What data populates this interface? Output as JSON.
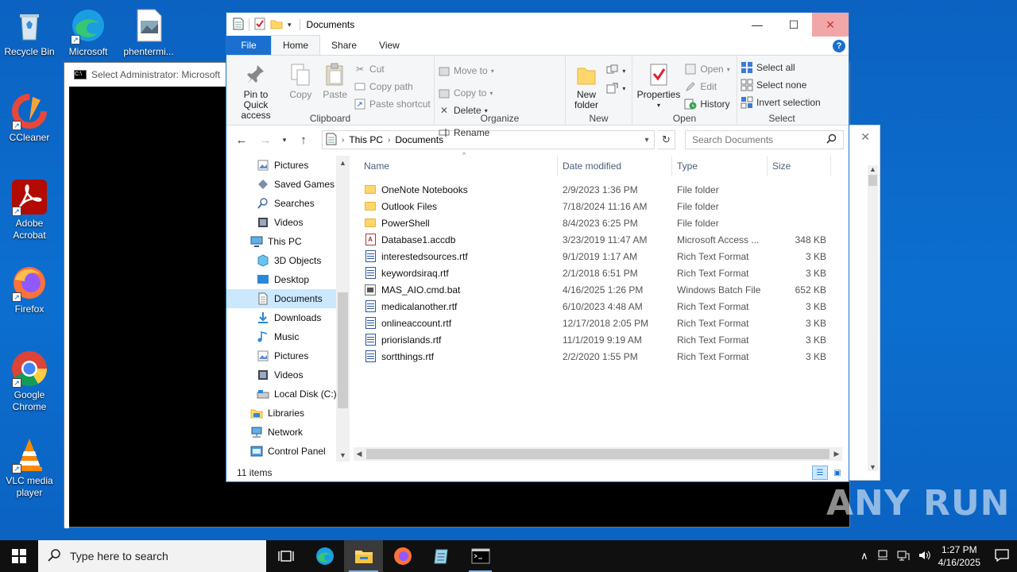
{
  "desktop": {
    "icons": [
      {
        "label": "Recycle Bin"
      },
      {
        "label": "Microsoft Edge"
      },
      {
        "label": "phentermi..."
      },
      {
        "label": "CCleaner"
      },
      {
        "label": "Adobe Acrobat"
      },
      {
        "label": "Firefox"
      },
      {
        "label": "Google Chrome"
      },
      {
        "label": "VLC media player"
      }
    ],
    "watermark": "ANY RUN"
  },
  "cmd": {
    "title": "Select Administrator:  Microsoft"
  },
  "explorer": {
    "title": "Documents",
    "tabs": [
      "File",
      "Home",
      "Share",
      "View"
    ],
    "ribbon": {
      "clipboard": {
        "label": "Clipboard",
        "pin": "Pin to Quick access",
        "copy": "Copy",
        "paste": "Paste",
        "cut": "Cut",
        "copy_path": "Copy path",
        "paste_shortcut": "Paste shortcut"
      },
      "organize": {
        "label": "Organize",
        "move_to": "Move to",
        "copy_to": "Copy to",
        "delete": "Delete",
        "rename": "Rename"
      },
      "new": {
        "label": "New",
        "new_folder": "New folder"
      },
      "open": {
        "label": "Open",
        "properties": "Properties",
        "open": "Open",
        "edit": "Edit",
        "history": "History"
      },
      "select": {
        "label": "Select",
        "select_all": "Select all",
        "select_none": "Select none",
        "invert": "Invert selection"
      }
    },
    "address": {
      "path": [
        "This PC",
        "Documents"
      ],
      "search_placeholder": "Search Documents"
    },
    "tree": [
      {
        "label": "Pictures",
        "icon": "pictures-icon",
        "indent": 2
      },
      {
        "label": "Saved Games",
        "icon": "saved-games-icon",
        "indent": 2
      },
      {
        "label": "Searches",
        "icon": "searches-icon",
        "indent": 2
      },
      {
        "label": "Videos",
        "icon": "videos-icon",
        "indent": 2
      },
      {
        "label": "This PC",
        "icon": "this-pc-icon",
        "indent": 1
      },
      {
        "label": "3D Objects",
        "icon": "3d-objects-icon",
        "indent": 2
      },
      {
        "label": "Desktop",
        "icon": "desktop-icon",
        "indent": 2
      },
      {
        "label": "Documents",
        "icon": "documents-icon",
        "indent": 2,
        "selected": true
      },
      {
        "label": "Downloads",
        "icon": "downloads-icon",
        "indent": 2
      },
      {
        "label": "Music",
        "icon": "music-icon",
        "indent": 2
      },
      {
        "label": "Pictures",
        "icon": "pictures-icon",
        "indent": 2
      },
      {
        "label": "Videos",
        "icon": "videos-icon",
        "indent": 2
      },
      {
        "label": "Local Disk (C:)",
        "icon": "local-disk-icon",
        "indent": 2
      },
      {
        "label": "Libraries",
        "icon": "libraries-icon",
        "indent": 1
      },
      {
        "label": "Network",
        "icon": "network-icon",
        "indent": 1
      },
      {
        "label": "Control Panel",
        "icon": "control-panel-icon",
        "indent": 1
      }
    ],
    "columns": [
      "Name",
      "Date modified",
      "Type",
      "Size"
    ],
    "files": [
      {
        "name": "OneNote Notebooks",
        "date": "2/9/2023 1:36 PM",
        "type": "File folder",
        "size": "",
        "icon": "folder"
      },
      {
        "name": "Outlook Files",
        "date": "7/18/2024 11:16 AM",
        "type": "File folder",
        "size": "",
        "icon": "folder"
      },
      {
        "name": "PowerShell",
        "date": "8/4/2023 6:25 PM",
        "type": "File folder",
        "size": "",
        "icon": "folder"
      },
      {
        "name": "Database1.accdb",
        "date": "3/23/2019 11:47 AM",
        "type": "Microsoft Access ...",
        "size": "348 KB",
        "icon": "access"
      },
      {
        "name": "interestedsources.rtf",
        "date": "9/1/2019 1:17 AM",
        "type": "Rich Text Format",
        "size": "3 KB",
        "icon": "rtf"
      },
      {
        "name": "keywordsiraq.rtf",
        "date": "2/1/2018 6:51 PM",
        "type": "Rich Text Format",
        "size": "3 KB",
        "icon": "rtf"
      },
      {
        "name": "MAS_AIO.cmd.bat",
        "date": "4/16/2025 1:26 PM",
        "type": "Windows Batch File",
        "size": "652 KB",
        "icon": "bat"
      },
      {
        "name": "medicalanother.rtf",
        "date": "6/10/2023 4:48 AM",
        "type": "Rich Text Format",
        "size": "3 KB",
        "icon": "rtf"
      },
      {
        "name": "onlineaccount.rtf",
        "date": "12/17/2018 2:05 PM",
        "type": "Rich Text Format",
        "size": "3 KB",
        "icon": "rtf"
      },
      {
        "name": "priorislands.rtf",
        "date": "11/1/2019 9:19 AM",
        "type": "Rich Text Format",
        "size": "3 KB",
        "icon": "rtf"
      },
      {
        "name": "sortthings.rtf",
        "date": "2/2/2020 1:55 PM",
        "type": "Rich Text Format",
        "size": "3 KB",
        "icon": "rtf"
      }
    ],
    "status": "11 items"
  },
  "taskbar": {
    "search_placeholder": "Type here to search",
    "time": "1:27 PM",
    "date": "4/16/2025"
  }
}
